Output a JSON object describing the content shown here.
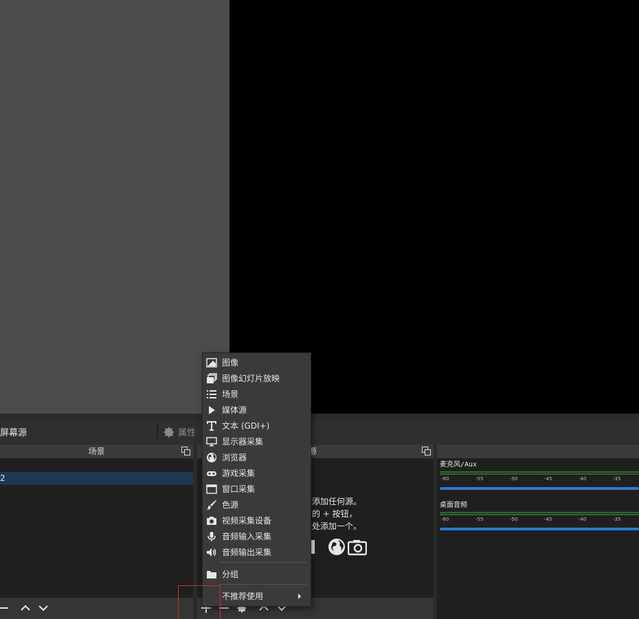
{
  "context_bar": {
    "source_label": "屏幕源",
    "properties_label": "属性"
  },
  "scenes_dock": {
    "title": "场景",
    "selected_scene": "2"
  },
  "sources_dock": {
    "title": "源",
    "empty_hint_lines": [
      "添加任何源。",
      "的 + 按钮，",
      "处添加一个。"
    ]
  },
  "mixer": {
    "tracks": [
      {
        "name": "麦克风/Aux"
      },
      {
        "name": "桌面音频"
      }
    ],
    "tick_labels": [
      "-60",
      "-55",
      "-50",
      "-45",
      "-40",
      "-35"
    ]
  },
  "context_menu": {
    "items": [
      {
        "label": "图像",
        "icon": "image-icon"
      },
      {
        "label": "图像幻灯片放映",
        "icon": "slideshow-icon"
      },
      {
        "label": "场景",
        "icon": "list-icon"
      },
      {
        "label": "媒体源",
        "icon": "play-icon"
      },
      {
        "label": "文本 (GDI+)",
        "icon": "text-icon"
      },
      {
        "label": "显示器采集",
        "icon": "monitor-icon"
      },
      {
        "label": "浏览器",
        "icon": "globe-icon"
      },
      {
        "label": "游戏采集",
        "icon": "gamepad-icon"
      },
      {
        "label": "窗口采集",
        "icon": "window-icon"
      },
      {
        "label": "色源",
        "icon": "brush-icon"
      },
      {
        "label": "视频采集设备",
        "icon": "camera-icon"
      },
      {
        "label": "音频输入采集",
        "icon": "microphone-icon"
      },
      {
        "label": "音频输出采集",
        "icon": "speaker-icon"
      }
    ],
    "group_label": "分组",
    "deprecated_label": "不推荐使用"
  },
  "colors": {
    "highlight_box": "#d42a2a",
    "volume_slider": "#2a7bd6",
    "meter_green": "#2b6b2b",
    "scene_selected": "#1e3752"
  }
}
